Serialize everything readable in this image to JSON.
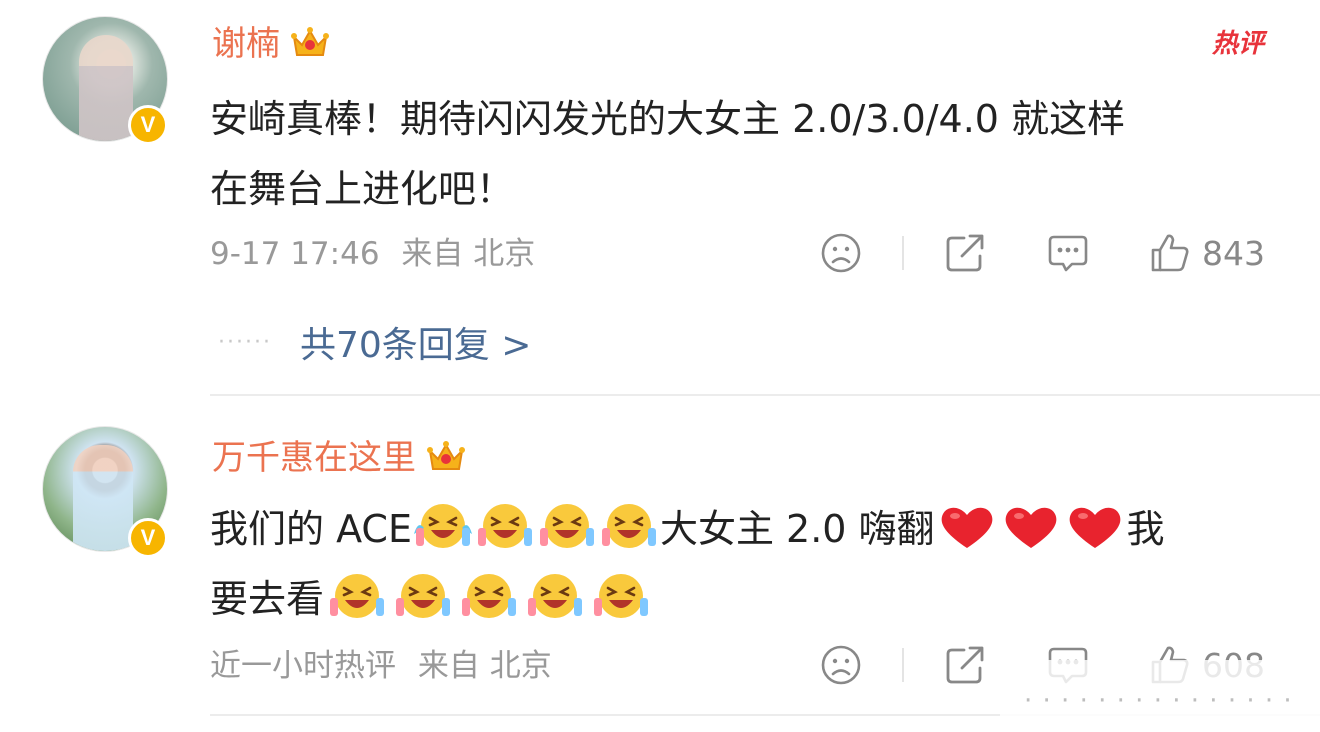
{
  "comments": [
    {
      "username": "谢楠",
      "hot_label": "热评",
      "text_line1": "安崎真棒！期待闪闪发光的大女主 2.0/3.0/4.0 就这样",
      "text_line2": "在舞台上进化吧！",
      "time": "9-17 17:46",
      "source": "来自 北京",
      "likes": "843",
      "replies": "共70条回复 >"
    },
    {
      "username": "万千惠在这里",
      "text_part1": "我们的 ACE",
      "text_part2": "大女主 2.0 嗨翻",
      "text_part3": "我",
      "text_part4": "要去看",
      "time": "近一小时热评",
      "source": "来自 北京",
      "likes": "608"
    }
  ],
  "watermark": "· · · · · · · · · · · · · · ·",
  "icons": [
    "crown-icon",
    "verified-v-icon",
    "dislike-face-icon",
    "share-icon",
    "comment-icon",
    "thumbs-up-icon",
    "laughing-emoji-icon",
    "red-heart-icon"
  ],
  "colors": {
    "username": "#eb7350",
    "link": "#4a6a93",
    "meta": "#999999",
    "hot": "#e8333b",
    "verified": "#f7b500"
  }
}
